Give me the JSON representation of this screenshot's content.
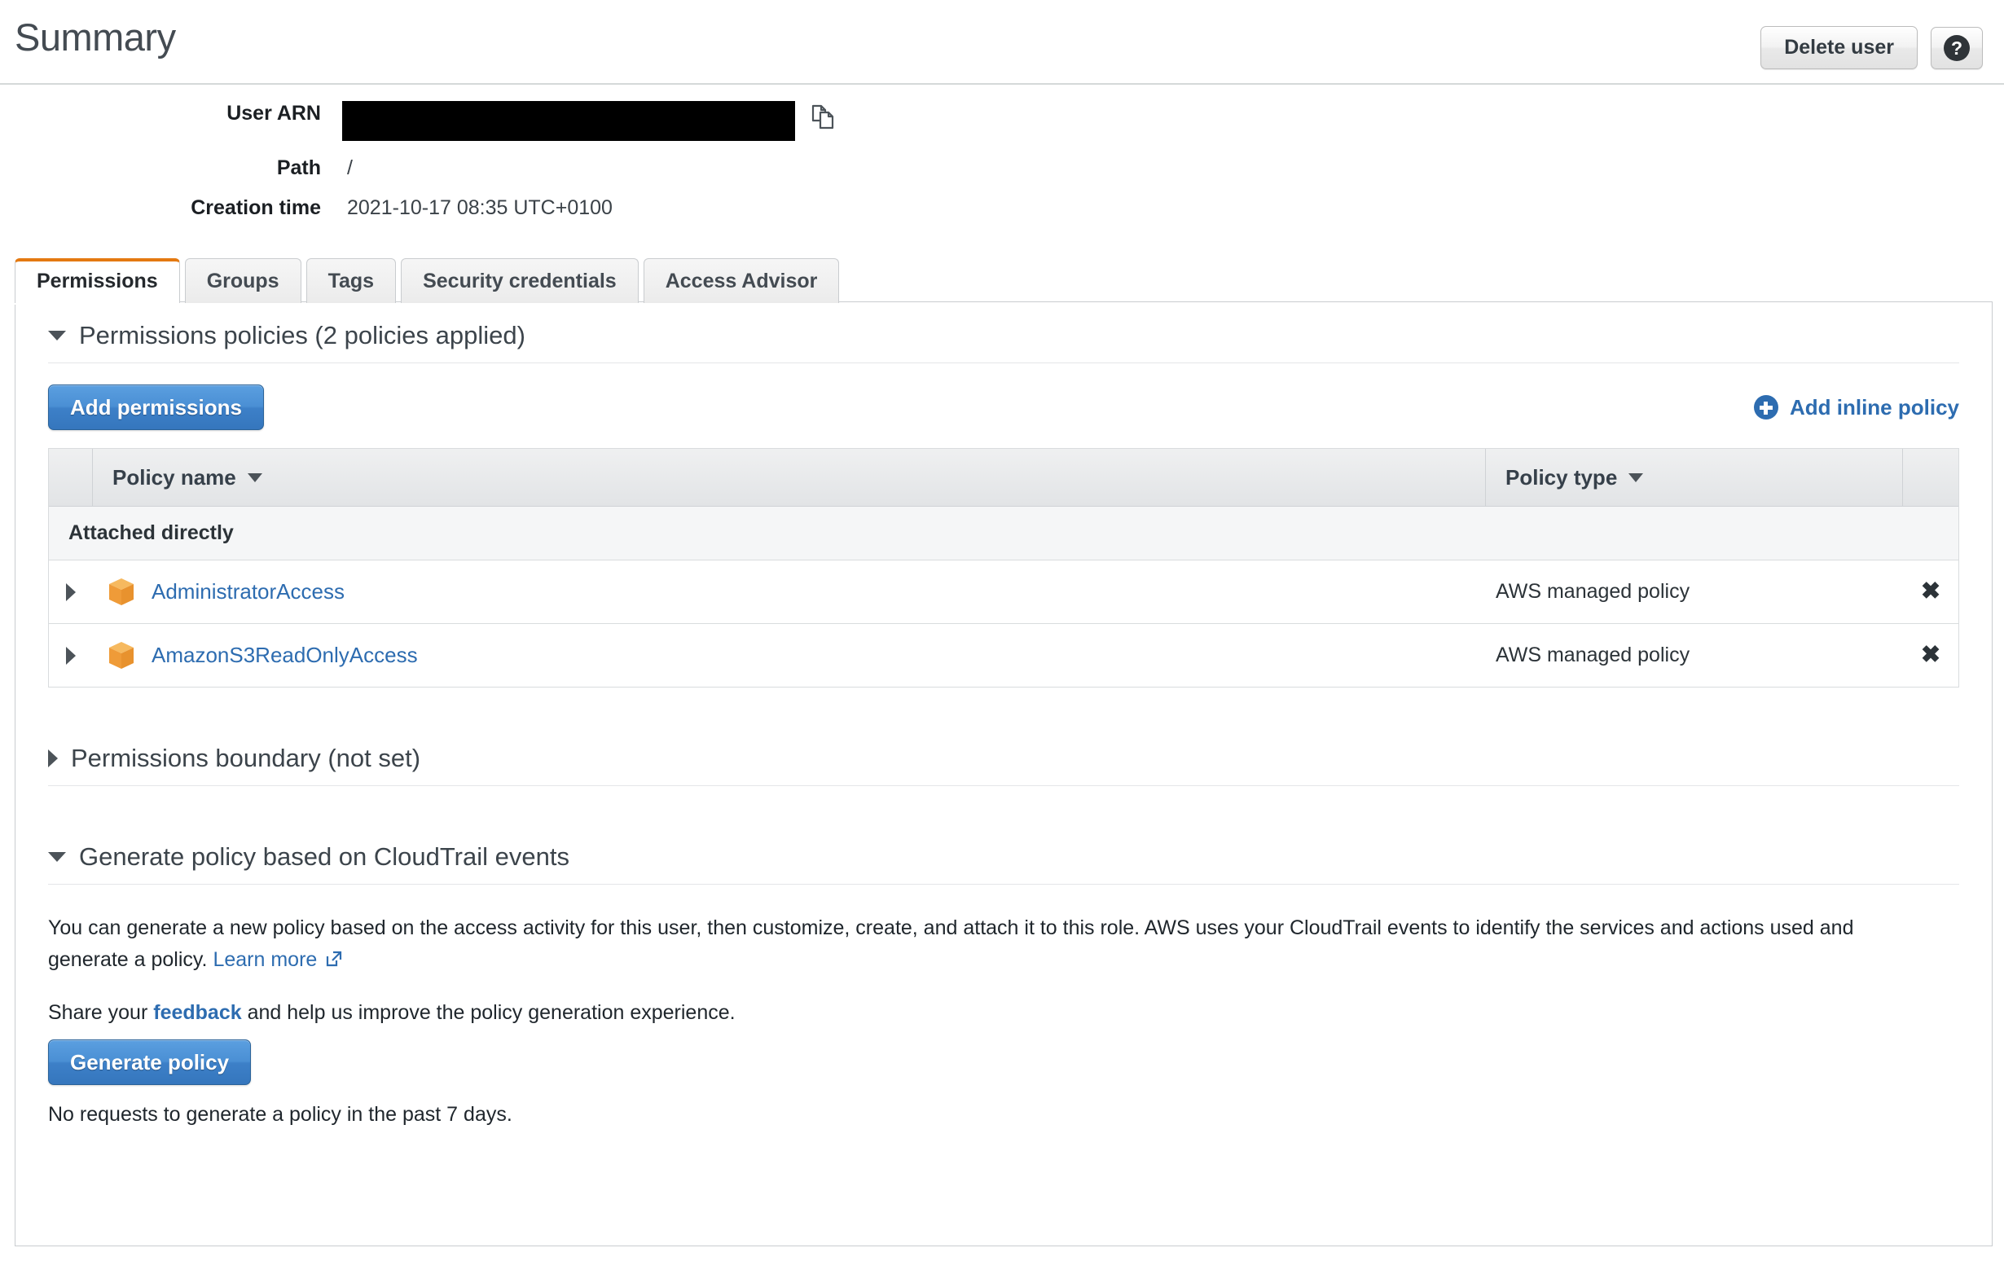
{
  "header": {
    "title": "Summary",
    "delete_user_label": "Delete user",
    "help_glyph": "?"
  },
  "summary": {
    "fields": [
      {
        "label": "User ARN",
        "value": "",
        "redacted": true
      },
      {
        "label": "Path",
        "value": "/"
      },
      {
        "label": "Creation time",
        "value": "2021-10-17 08:35 UTC+0100"
      }
    ],
    "user_arn_label": "User ARN",
    "path_label": "Path",
    "path_value": "/",
    "creation_time_label": "Creation time",
    "creation_time_value": "2021-10-17 08:35 UTC+0100"
  },
  "tabs": [
    {
      "label": "Permissions",
      "active": true
    },
    {
      "label": "Groups",
      "active": false
    },
    {
      "label": "Tags",
      "active": false
    },
    {
      "label": "Security credentials",
      "active": false
    },
    {
      "label": "Access Advisor",
      "active": false
    }
  ],
  "permissions_section": {
    "title": "Permissions policies (2 policies applied)",
    "add_permissions_label": "Add permissions",
    "add_inline_policy_label": "Add inline policy",
    "table": {
      "columns": [
        "Policy name",
        "Policy type"
      ],
      "group_label": "Attached directly",
      "rows": [
        {
          "policy_name": "AdministratorAccess",
          "policy_type": "AWS managed policy",
          "remove_glyph": "✖"
        },
        {
          "policy_name": "AmazonS3ReadOnlyAccess",
          "policy_type": "AWS managed policy",
          "remove_glyph": "✖"
        }
      ]
    }
  },
  "permissions_boundary": {
    "title": "Permissions boundary (not set)"
  },
  "generate_policy": {
    "title": "Generate policy based on CloudTrail events",
    "description_part1": "You can generate a new policy based on the access activity for this user, then customize, create, and attach it to this role. AWS uses your CloudTrail events to identify the services and actions used and generate a policy.",
    "learn_more_label": "Learn more",
    "feedback_prefix": "Share your ",
    "feedback_link_label": "feedback",
    "feedback_suffix": " and help us improve the policy generation experience.",
    "generate_button_label": "Generate policy",
    "no_requests_note": "No requests to generate a policy in the past 7 days."
  },
  "colors": {
    "accent_orange": "#e47911",
    "link_blue": "#2d6cb0",
    "primary_button_blue": "#3d80c8",
    "cube_orange": "#ef9b38",
    "title_gray": "#444b52"
  },
  "icons": {
    "copy": "copy-icon",
    "help": "help-icon",
    "external_link": "external-link-icon",
    "policy_cube": "policy-cube-icon",
    "plus_circle": "plus-circle-icon"
  }
}
